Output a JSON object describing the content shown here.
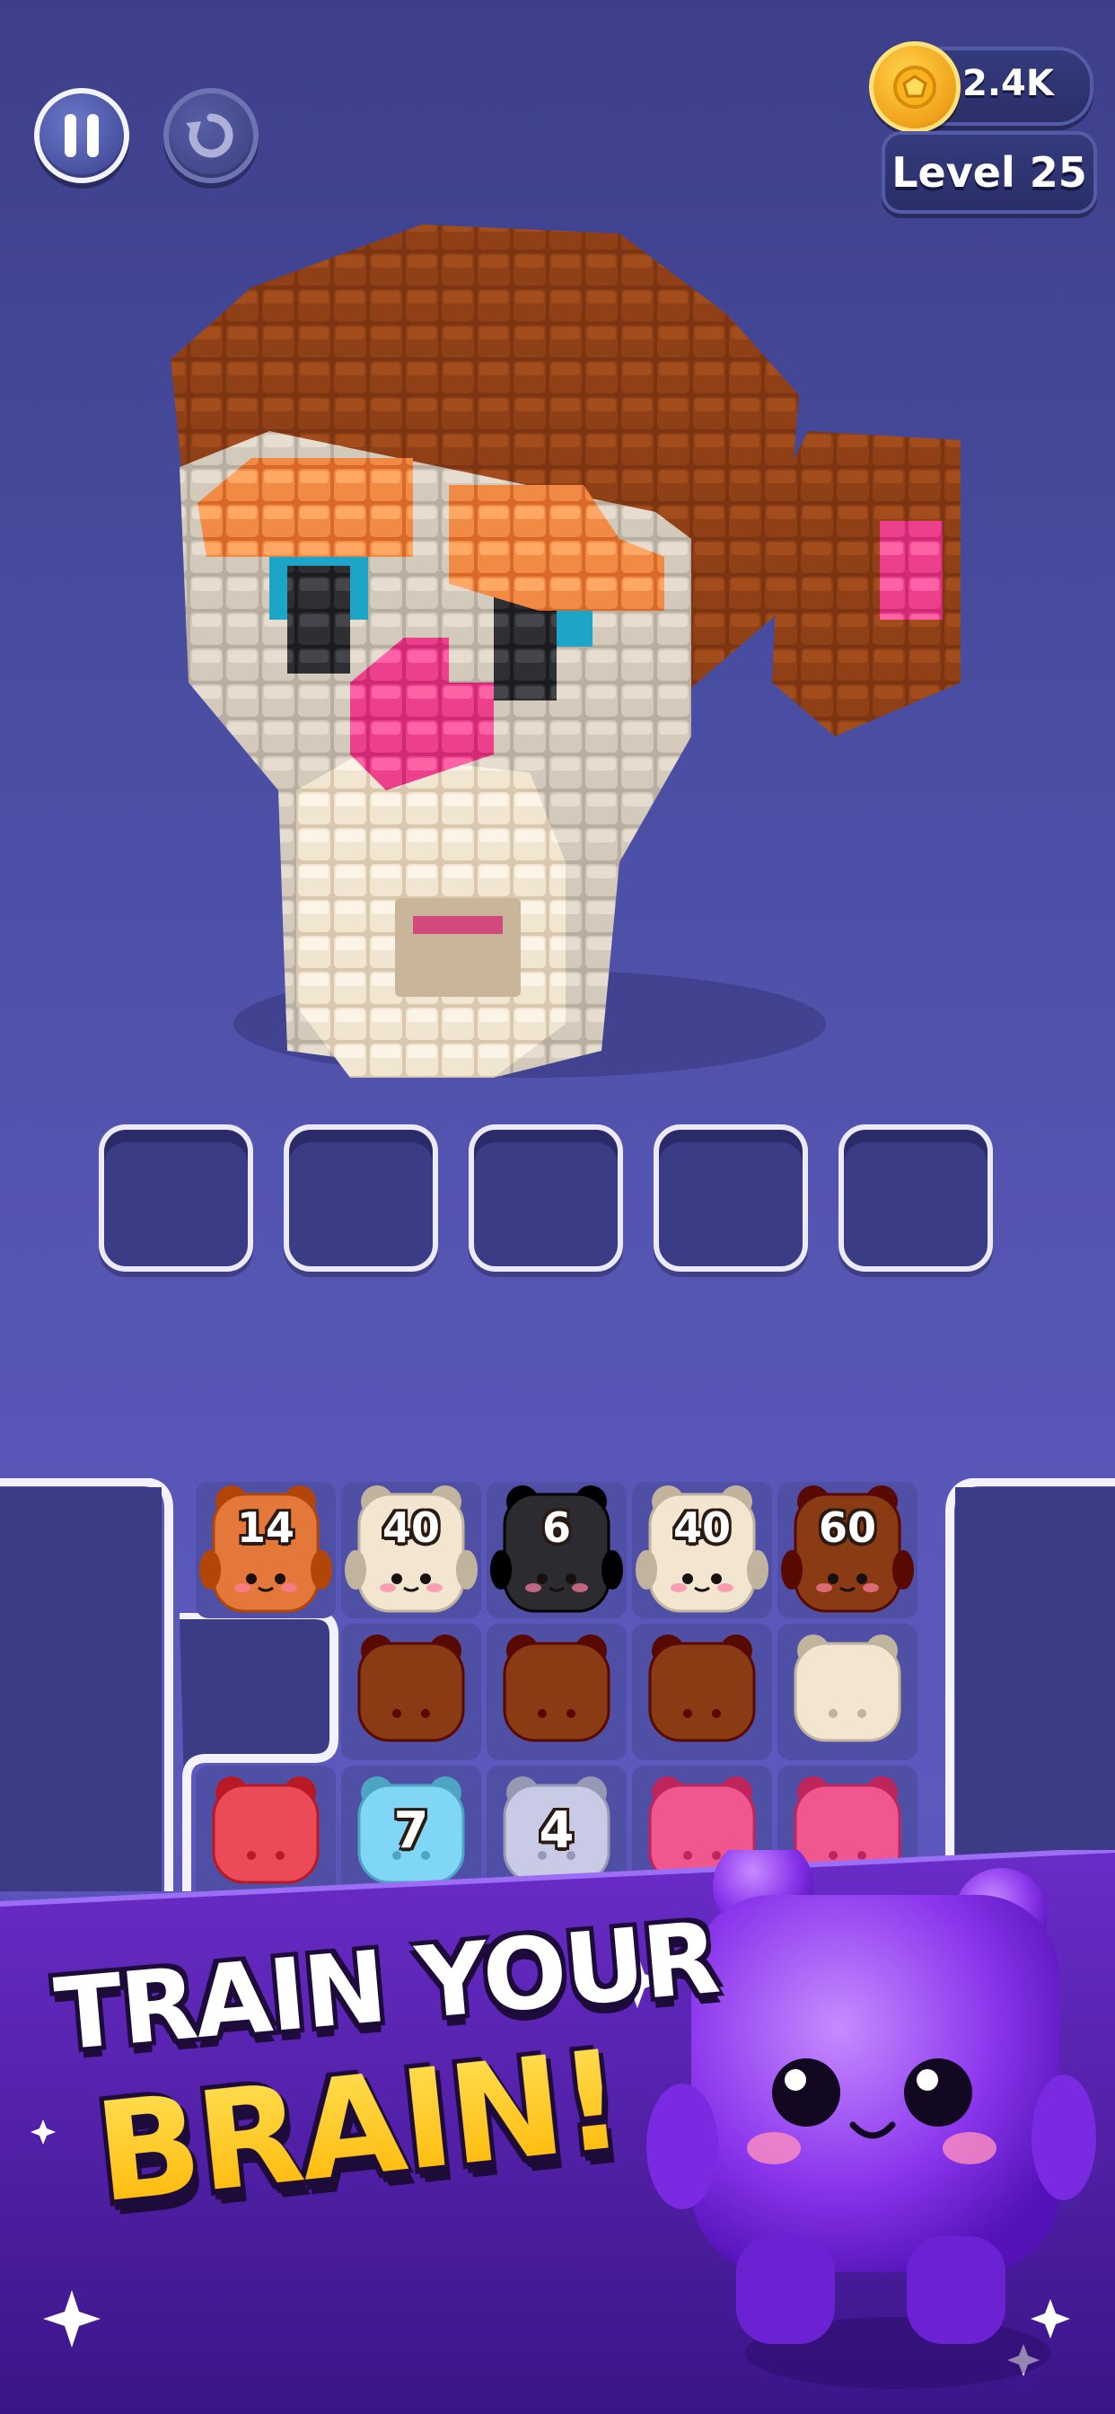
{
  "hud": {
    "pause_icon": "pause-icon",
    "restart_icon": "restart-icon",
    "coins": "2.4K",
    "coin_icon": "coin-icon",
    "level": "Level 25"
  },
  "slots": {
    "count": 5,
    "filled": []
  },
  "board": {
    "rows": [
      [
        {
          "color": "orange",
          "number": "14"
        },
        {
          "color": "cream",
          "number": "40"
        },
        {
          "color": "black",
          "number": "6"
        },
        {
          "color": "cream",
          "number": "40"
        },
        {
          "color": "brown",
          "number": "60"
        }
      ],
      [
        null,
        {
          "color": "brown",
          "number": ""
        },
        {
          "color": "brown",
          "number": ""
        },
        {
          "color": "brown",
          "number": ""
        },
        {
          "color": "cream",
          "number": ""
        }
      ],
      [
        {
          "color": "red",
          "number": ""
        },
        {
          "color": "ice-blue",
          "number": "7"
        },
        {
          "color": "silver",
          "number": "4"
        },
        {
          "color": "pink",
          "number": ""
        },
        {
          "color": "pink",
          "number": ""
        }
      ]
    ]
  },
  "promo": {
    "line1": "TRAIN YOUR",
    "line2": "BRAIN!",
    "mascot": "purple-jelly-bear-cube"
  },
  "colors": {
    "orange": "#e4773a",
    "cream": "#f3e6d1",
    "black": "#2c2c30",
    "brown": "#8a3b14",
    "red": "#ea4b57",
    "pink": "#f0578f",
    "ice-blue": "#7fd6f5",
    "silver": "#c9cbe6",
    "banner": "#5a20b8",
    "title-yellow": "#ffcd1c"
  }
}
